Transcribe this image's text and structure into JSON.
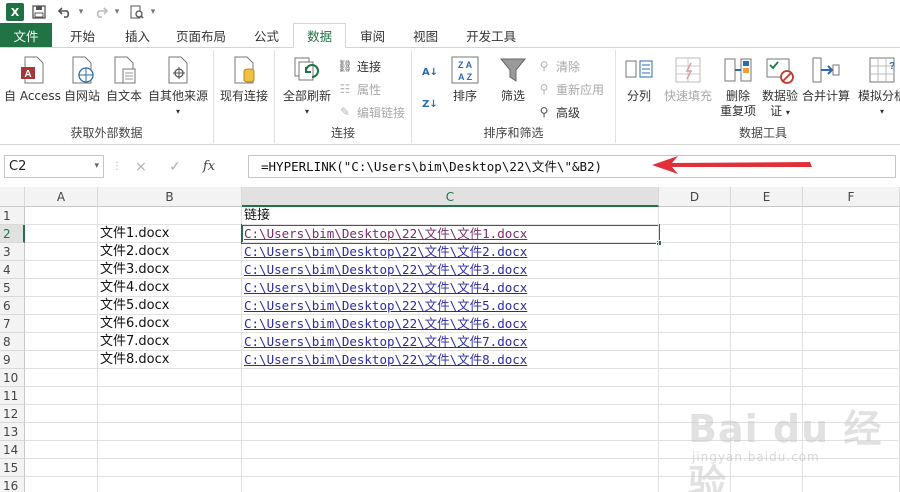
{
  "quick_access": {
    "excel_icon": "X",
    "save_icon": "save-icon",
    "undo_icon": "undo-icon",
    "redo_icon": "redo-icon",
    "print_preview_icon": "print-preview-icon"
  },
  "tabs": [
    {
      "label": "文件",
      "kind": "file"
    },
    {
      "label": "开始"
    },
    {
      "label": "插入"
    },
    {
      "label": "页面布局"
    },
    {
      "label": "公式"
    },
    {
      "label": "数据",
      "active": true
    },
    {
      "label": "审阅"
    },
    {
      "label": "视图"
    },
    {
      "label": "开发工具"
    }
  ],
  "ribbon": {
    "group_external": {
      "label": "获取外部数据",
      "buttons": [
        "自 Access",
        "自网站",
        "自文本",
        "自其他来源"
      ]
    },
    "existing_connections": "现有连接",
    "group_connections": {
      "label": "连接",
      "refresh_all": "全部刷新",
      "connections": "连接",
      "properties": "属性",
      "edit_links": "编辑链接"
    },
    "group_sort": {
      "label": "排序和筛选",
      "sort": "排序",
      "filter": "筛选",
      "clear": "清除",
      "reapply": "重新应用",
      "advanced": "高级"
    },
    "group_tools": {
      "label": "数据工具",
      "text_to_columns": "分列",
      "flash_fill": "快速填充",
      "remove_duplicates_1": "删除",
      "remove_duplicates_2": "重复项",
      "validation_1": "数据验",
      "validation_2": "证",
      "consolidate": "合并计算",
      "what_if": "模拟分析"
    }
  },
  "formula_bar": {
    "name_box": "C2",
    "cancel_icon": "×",
    "enter_icon": "✓",
    "fx_label": "fx",
    "formula": "=HYPERLINK(\"C:\\Users\\bim\\Desktop\\22\\文件\\\"&B2)"
  },
  "columns": [
    "A",
    "B",
    "C",
    "D",
    "E",
    "F"
  ],
  "selected_column": "C",
  "rows": [
    "1",
    "2",
    "3",
    "4",
    "5",
    "6",
    "7",
    "8",
    "9",
    "10",
    "11",
    "12",
    "13",
    "14",
    "15",
    "16"
  ],
  "selected_row": "2",
  "cells": {
    "C1": "链接",
    "B": [
      "文件1.docx",
      "文件2.docx",
      "文件3.docx",
      "文件4.docx",
      "文件5.docx",
      "文件6.docx",
      "文件7.docx",
      "文件8.docx"
    ],
    "C": [
      "C:\\Users\\bim\\Desktop\\22\\文件\\文件1.docx",
      "C:\\Users\\bim\\Desktop\\22\\文件\\文件2.docx",
      "C:\\Users\\bim\\Desktop\\22\\文件\\文件3.docx",
      "C:\\Users\\bim\\Desktop\\22\\文件\\文件4.docx",
      "C:\\Users\\bim\\Desktop\\22\\文件\\文件5.docx",
      "C:\\Users\\bim\\Desktop\\22\\文件\\文件6.docx",
      "C:\\Users\\bim\\Desktop\\22\\文件\\文件7.docx",
      "C:\\Users\\bim\\Desktop\\22\\文件\\文件8.docx"
    ]
  },
  "colors": {
    "excel_green": "#217346",
    "hyperlink": "#2b2ba8",
    "visited_link": "#7a2b6a",
    "annotation_arrow": "#e0303a"
  },
  "watermark": {
    "brand": "Bai du 经验",
    "url": "jingyan.baidu.com"
  }
}
